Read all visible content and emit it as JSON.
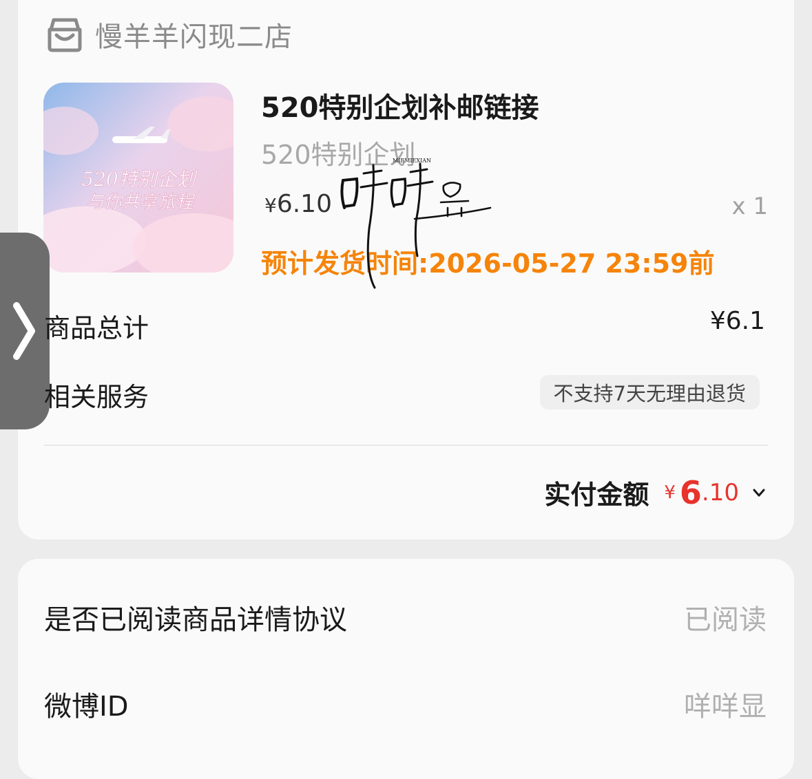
{
  "shop": {
    "name": "慢羊羊闪现二店",
    "icon": "store-icon"
  },
  "product": {
    "image_text_line1": "520特别企划",
    "image_text_line2": "与你共享旅程",
    "title": "520特别企划补邮链接",
    "spec": "520特别企划",
    "price_yen": "¥",
    "price": "6.10",
    "quantity": "x 1",
    "shipping": "预计发货时间:2026-05-27 23:59前"
  },
  "signature": {
    "text": "咩咩显",
    "small_text": "MIEMIEXIAN"
  },
  "summary": {
    "total_label": "商品总计",
    "total_value": "¥6.1",
    "service_label": "相关服务",
    "service_badge": "不支持7天无理由退货",
    "paid_label": "实付金额",
    "paid_yen": "¥",
    "paid_int": "6",
    "paid_dec": ".10"
  },
  "info": {
    "read_label": "是否已阅读商品详情协议",
    "read_value": "已阅读",
    "weibo_label": "微博ID",
    "weibo_value": "咩咩显"
  },
  "colors": {
    "accent_orange": "#f5840a",
    "price_red": "#e8322c",
    "side_tab": "#6d6d6d"
  }
}
